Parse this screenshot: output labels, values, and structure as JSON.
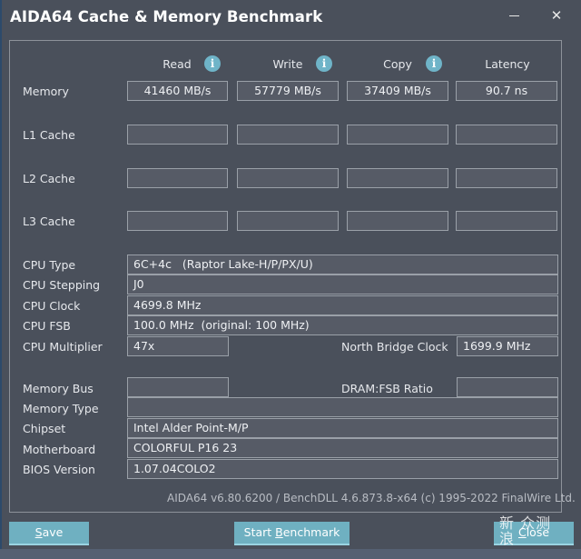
{
  "window": {
    "title": "AIDA64 Cache & Memory Benchmark",
    "minimize_icon": "minimize-icon",
    "close_icon": "close-icon",
    "close_glyph": "✕"
  },
  "columns": [
    "Read",
    "Write",
    "Copy",
    "Latency"
  ],
  "info_glyph": "i",
  "bench_rows": [
    {
      "label": "Memory",
      "values": [
        "41460 MB/s",
        "57779 MB/s",
        "37409 MB/s",
        "90.7 ns"
      ]
    },
    {
      "label": "L1 Cache",
      "values": [
        "",
        "",
        "",
        ""
      ]
    },
    {
      "label": "L2 Cache",
      "values": [
        "",
        "",
        "",
        ""
      ]
    },
    {
      "label": "L3 Cache",
      "values": [
        "",
        "",
        "",
        ""
      ]
    }
  ],
  "cpu": {
    "type_label": "CPU Type",
    "type_value": "6C+4c   (Raptor Lake-H/P/PX/U)",
    "stepping_label": "CPU Stepping",
    "stepping_value": "J0",
    "clock_label": "CPU Clock",
    "clock_value": "4699.8 MHz",
    "fsb_label": "CPU FSB",
    "fsb_value": "100.0 MHz  (original: 100 MHz)",
    "multiplier_label": "CPU Multiplier",
    "multiplier_value": "47x",
    "nb_clock_label": "North Bridge Clock",
    "nb_clock_value": "1699.9 MHz"
  },
  "memory": {
    "bus_label": "Memory Bus",
    "bus_value": "",
    "dram_ratio_label": "DRAM:FSB Ratio",
    "dram_ratio_value": "",
    "type_label": "Memory Type",
    "type_value": "",
    "chipset_label": "Chipset",
    "chipset_value": "Intel Alder Point-M/P",
    "motherboard_label": "Motherboard",
    "motherboard_value": "COLORFUL P16 23",
    "bios_label": "BIOS Version",
    "bios_value": "1.07.04COLO2"
  },
  "footer": "AIDA64 v6.80.6200 / BenchDLL 4.6.873.8-x64  (c) 1995-2022 FinalWire Ltd.",
  "buttons": {
    "save_mnemonic": "S",
    "save_rest": "ave",
    "start_pre": "Start ",
    "start_mnemonic": "B",
    "start_rest": "enchmark",
    "close_mnemonic": "C",
    "close_rest": "lose"
  },
  "watermark": {
    "line1": "新 众测",
    "line2": "浪"
  }
}
